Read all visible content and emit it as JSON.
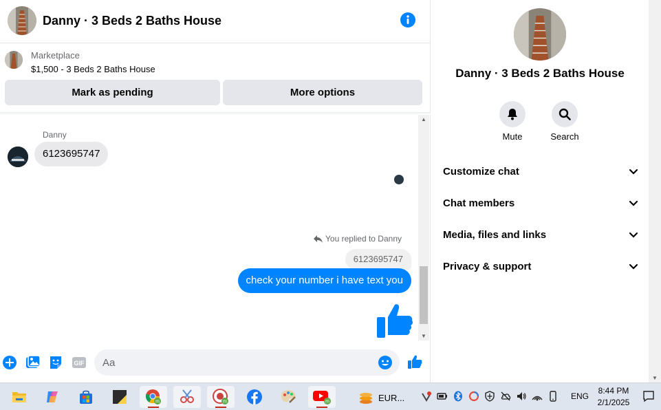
{
  "header": {
    "title": "Danny · 3 Beds 2 Baths House"
  },
  "marketplace": {
    "label": "Marketplace",
    "listing": "$1,500 - 3 Beds 2 Baths House",
    "pending_label": "Mark as pending",
    "more_label": "More options"
  },
  "messages": {
    "sender": "Danny",
    "incoming_text": "6123695747",
    "replied_label": "You replied to Danny",
    "quoted_text": "6123695747",
    "outgoing_text": "check your number i have text you"
  },
  "composer": {
    "placeholder": "Aa"
  },
  "info_panel": {
    "title": "Danny · 3 Beds 2 Baths House",
    "mute_label": "Mute",
    "search_label": "Search",
    "sections": [
      "Customize chat",
      "Chat members",
      "Media, files and links",
      "Privacy & support"
    ]
  },
  "taskbar": {
    "weather_text": "EUR...",
    "language": "ENG",
    "time": "8:44 PM",
    "date": "2/1/2025"
  },
  "colors": {
    "accent": "#0084ff",
    "bubble_in": "#e9e9eb",
    "button_bg": "#e4e6eb"
  }
}
